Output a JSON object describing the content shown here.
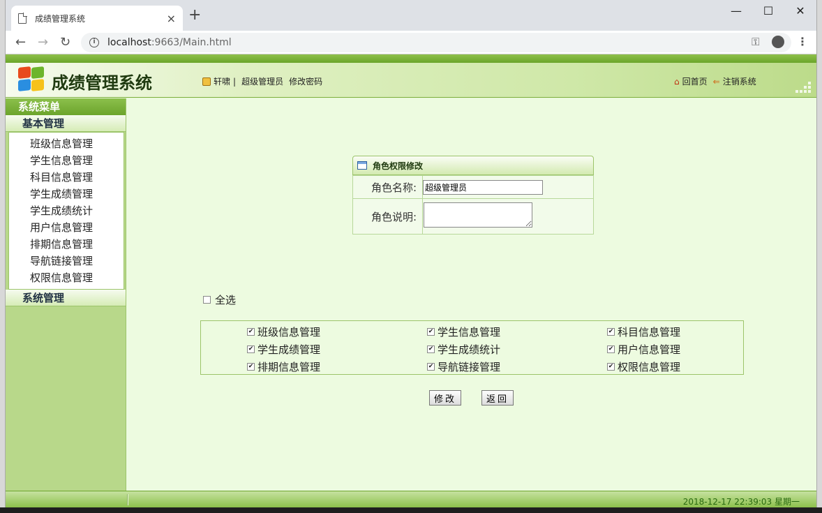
{
  "browser": {
    "tab_title": "成绩管理系统",
    "tab_close": "×",
    "new_tab": "+",
    "minimize": "—",
    "maximize": "☐",
    "close": "✕",
    "back": "←",
    "forward": "→",
    "reload": "↻",
    "url_host": "localhost",
    "url_rest": ":9663/Main.html",
    "key_icon": "⚿",
    "star_icon": "☆",
    "menu": "⋮"
  },
  "header": {
    "app_title": "成绩管理系统",
    "user_name": "轩啸",
    "separator": "|",
    "role": "超级管理员",
    "change_password": "修改密码",
    "home_link": "回首页",
    "logout_link": "注销系统"
  },
  "sidebar": {
    "title": "系统菜单",
    "group_basic": "基本管理",
    "items": [
      {
        "label": "班级信息管理"
      },
      {
        "label": "学生信息管理"
      },
      {
        "label": "科目信息管理"
      },
      {
        "label": "学生成绩管理"
      },
      {
        "label": "学生成绩统计"
      },
      {
        "label": "用户信息管理"
      },
      {
        "label": "排期信息管理"
      },
      {
        "label": "导航链接管理"
      },
      {
        "label": "权限信息管理"
      }
    ],
    "group_system": "系统管理"
  },
  "form": {
    "panel_title": "角色权限修改",
    "role_name_label": "角色名称:",
    "role_name_value": "超级管理员",
    "role_desc_label": "角色说明:",
    "role_desc_value": ""
  },
  "permissions": {
    "select_all_label": "全选",
    "select_all_checked": false,
    "items": [
      {
        "label": "班级信息管理",
        "checked": true
      },
      {
        "label": "学生信息管理",
        "checked": true
      },
      {
        "label": "科目信息管理",
        "checked": true
      },
      {
        "label": "学生成绩管理",
        "checked": true
      },
      {
        "label": "学生成绩统计",
        "checked": true
      },
      {
        "label": "用户信息管理",
        "checked": true
      },
      {
        "label": "排期信息管理",
        "checked": true
      },
      {
        "label": "导航链接管理",
        "checked": true
      },
      {
        "label": "权限信息管理",
        "checked": true
      }
    ]
  },
  "buttons": {
    "modify": "修改",
    "back": "返回"
  },
  "status": {
    "datetime": "2018-12-17 22:39:03 星期一"
  }
}
